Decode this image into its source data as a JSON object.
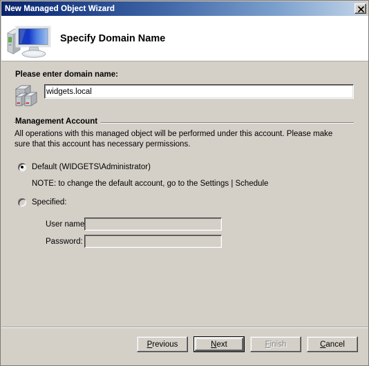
{
  "window": {
    "title": "New Managed Object Wizard",
    "close_icon": "close-icon"
  },
  "header": {
    "title": "Specify Domain Name",
    "icon": "computer-monitor-icon"
  },
  "domain_section": {
    "label": "Please enter domain name:",
    "icon": "server-stack-icon",
    "value": "widgets.local",
    "placeholder": ""
  },
  "management_account": {
    "legend": "Management Account",
    "description": "All operations with this managed object will be performed under this account. Please make sure that this account has necessary permissions.",
    "default_option": {
      "label": "Default (WIDGETS\\Administrator)",
      "selected": true
    },
    "note": "NOTE: to change the default account, go to the Settings | Schedule",
    "specified_option": {
      "label": "Specified:",
      "selected": false
    },
    "username": {
      "label": "User name:",
      "value": "",
      "placeholder": ""
    },
    "password": {
      "label": "Password:",
      "value": "",
      "placeholder": ""
    }
  },
  "buttons": {
    "previous": {
      "prefix": "",
      "mnemonic": "P",
      "suffix": "revious"
    },
    "next": {
      "prefix": "",
      "mnemonic": "N",
      "suffix": "ext"
    },
    "finish": {
      "prefix": "",
      "mnemonic": "F",
      "suffix": "inish"
    },
    "cancel": {
      "prefix": "",
      "mnemonic": "C",
      "suffix": "ancel"
    }
  },
  "colors": {
    "dialog_face": "#d4d0c8",
    "titlebar_start": "#0a246a",
    "titlebar_end": "#b6cbe4",
    "header_band": "#ffffff",
    "disabled_text": "#808080"
  }
}
